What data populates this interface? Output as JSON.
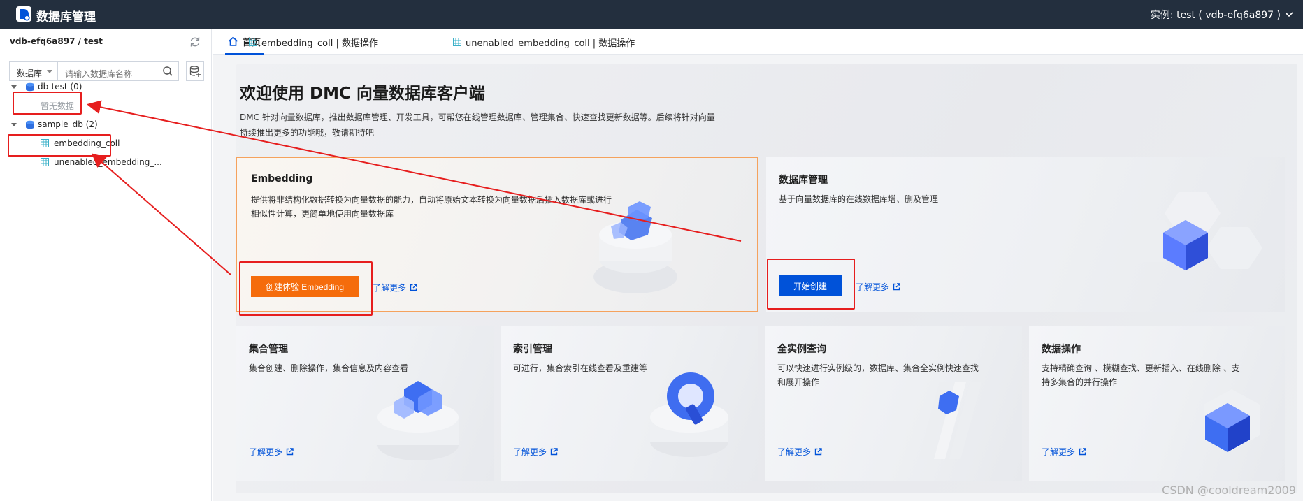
{
  "header": {
    "app_title": "数据库管理",
    "instance_label": "实例: test ( vdb-efq6a897 )"
  },
  "sidebar": {
    "path": "vdb-efq6a897 / test",
    "select_value": "数据库",
    "search_placeholder": "请输入数据库名称",
    "tree": [
      {
        "label": "db-test (0)",
        "empty_text": "暂无数据"
      },
      {
        "label": "sample_db (2)",
        "children": [
          "embedding_coll",
          "unenabled_embedding_..."
        ]
      }
    ]
  },
  "tabs": [
    {
      "label": "首页",
      "active": true
    },
    {
      "label": "embedding_coll | 数据操作"
    },
    {
      "label": "unenabled_embedding_coll | 数据操作"
    }
  ],
  "hero": {
    "title": "欢迎使用 DMC 向量数据库客户端",
    "desc_line1": "DMC 针对向量数据库，推出数据库管理、开发工具，可帮您在线管理数据库、管理集合、快速查找更新数据等。后续将针对向量",
    "desc_line2": "持续推出更多的功能哦，敬请期待吧"
  },
  "cards": {
    "embedding": {
      "title": "Embedding",
      "desc_line1": "提供将非结构化数据转换为向量数据的能力，自动将原始文本转换为向量数据后插入数据库或进行",
      "desc_line2": "相似性计算，更简单地使用向量数据库",
      "button": "创建体验 Embedding",
      "learn_more": "了解更多"
    },
    "db_manage": {
      "title": "数据库管理",
      "desc": "基于向量数据库的在线数据库增、删及管理",
      "button": "开始创建",
      "learn_more": "了解更多"
    },
    "collection": {
      "title": "集合管理",
      "desc": "集合创建、删除操作，集合信息及内容查看",
      "learn_more": "了解更多"
    },
    "index": {
      "title": "索引管理",
      "desc": "可进行，集合索引在线查看及重建等",
      "learn_more": "了解更多"
    },
    "query": {
      "title": "全实例查询",
      "desc_line1": "可以快速进行实例级的，数据库、集合全实例快速查找",
      "desc_line2": "和展开操作",
      "learn_more": "了解更多"
    },
    "data_ops": {
      "title": "数据操作",
      "desc_line1": "支持精确查询 、模糊查找、更新插入、在线删除 、支",
      "desc_line2": "持多集合的并行操作",
      "learn_more": "了解更多"
    }
  },
  "watermark": "CSDN @cooldream2009",
  "colors": {
    "topbar": "#232f3e",
    "accent_blue": "#0052d9",
    "accent_orange": "#f56c0c",
    "annotation_red": "#e61e1e"
  }
}
